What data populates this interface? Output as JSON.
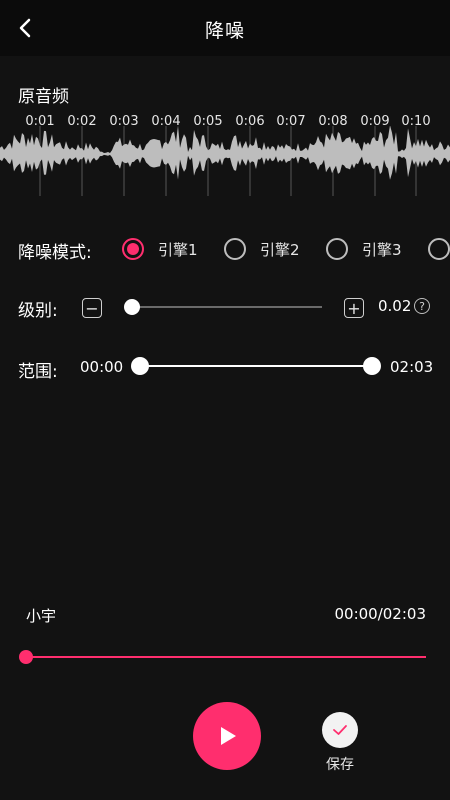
{
  "header": {
    "back_icon": "back-arrow-icon",
    "title": "降噪"
  },
  "waveform": {
    "section_title": "原音频",
    "ticks": [
      "0:01",
      "0:02",
      "0:03",
      "0:04",
      "0:05",
      "0:06",
      "0:07",
      "0:08",
      "0:09",
      "0:10"
    ],
    "color": "#bdbdbd"
  },
  "mode": {
    "label": "降噪模式:",
    "options": [
      {
        "label": "引擎1",
        "selected": true
      },
      {
        "label": "引擎2",
        "selected": false
      },
      {
        "label": "引擎3",
        "selected": false
      },
      {
        "label": "",
        "selected": false
      }
    ]
  },
  "level": {
    "label": "级别:",
    "minus": "−",
    "plus": "+",
    "value": "0.02",
    "help": "?",
    "fraction": 0.02
  },
  "range": {
    "label": "范围:",
    "start": "00:00",
    "end": "02:03"
  },
  "player": {
    "track_name": "小宇",
    "time": "00:00/02:03",
    "progress_fraction": 0.0,
    "accent": "#ff2e6e",
    "save_label": "保存"
  }
}
